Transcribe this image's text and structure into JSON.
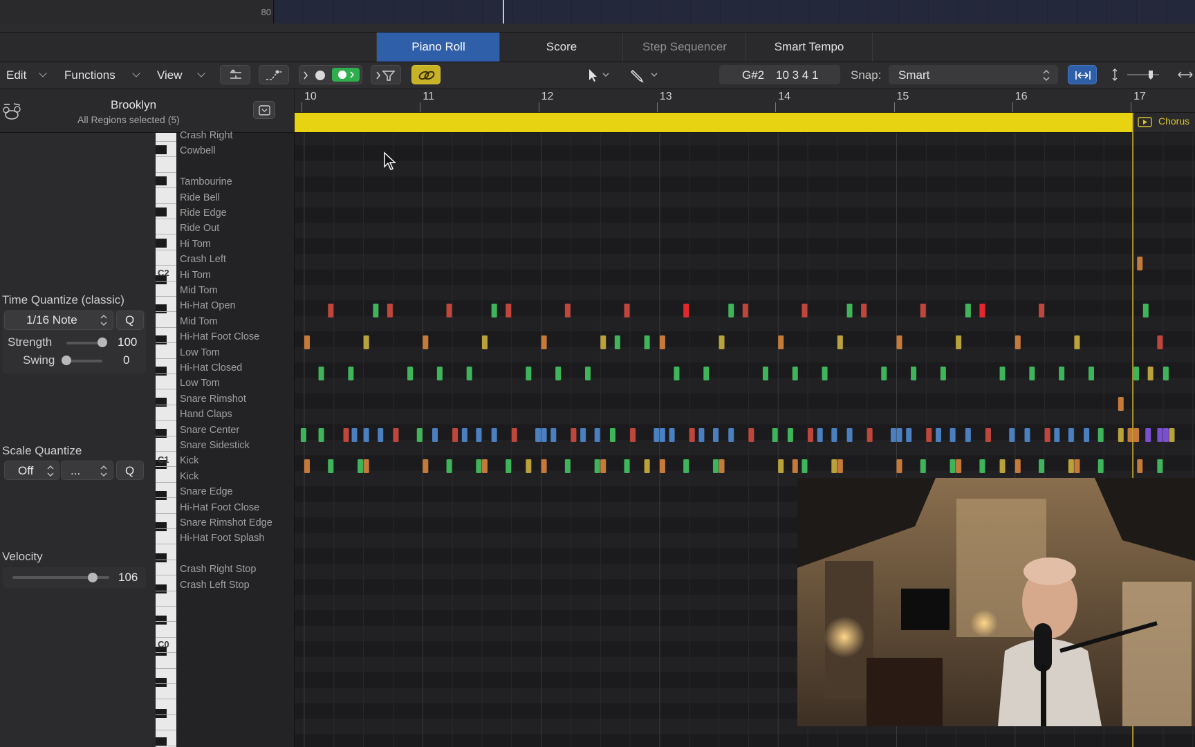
{
  "top": {
    "track_number": "80"
  },
  "tabs": [
    {
      "label": "Piano Roll"
    },
    {
      "label": "Score"
    },
    {
      "label": "Step Sequencer"
    },
    {
      "label": "Smart Tempo"
    }
  ],
  "toolbar": {
    "menus": [
      {
        "label": "Edit"
      },
      {
        "label": "Functions"
      },
      {
        "label": "View"
      }
    ],
    "position_note": "G#2",
    "position_value": "10 3 4 1",
    "snap_label": "Snap:",
    "snap_value": "Smart"
  },
  "region": {
    "name": "Brooklyn",
    "selection": "All Regions selected (5)"
  },
  "inspector": {
    "time_quantize": {
      "label": "Time Quantize (classic)",
      "value": "1/16 Note",
      "q": "Q",
      "strength_label": "Strength",
      "strength_value": "100",
      "strength_fraction": 1.0,
      "swing_label": "Swing",
      "swing_value": "0",
      "swing_fraction": 0.0
    },
    "scale_quantize": {
      "label": "Scale Quantize",
      "value": "Off",
      "scale": "...",
      "q": "Q"
    },
    "velocity": {
      "label": "Velocity",
      "value": "106",
      "fraction": 0.83
    }
  },
  "keyboard": {
    "octaves": [
      "C2",
      "C1",
      "C0"
    ]
  },
  "drum_names": [
    "Crash Right",
    "Cowbell",
    "",
    "Tambourine",
    "Ride Bell",
    "Ride Edge",
    "Ride Out",
    "Hi Tom",
    "Crash Left",
    "Hi Tom",
    "Mid Tom",
    "Hi-Hat Open",
    "Mid Tom",
    "Hi-Hat Foot Close",
    "Low Tom",
    "Hi-Hat Closed",
    "Low Tom",
    "Snare Rimshot",
    "Hand Claps",
    "Snare Center",
    "Snare Sidestick",
    "Kick",
    "Kick",
    "Snare Edge",
    "Hi-Hat Foot Close",
    "Snare Rimshot Edge",
    "Hi-Hat Foot Splash",
    "",
    "Crash Right Stop",
    "Crash Left Stop"
  ],
  "ruler": {
    "bars": [
      "10",
      "11",
      "12",
      "13",
      "14",
      "15",
      "16",
      "17"
    ]
  },
  "next_region": {
    "label": "Chorus"
  },
  "colors": {
    "tab_active": "#2f5fa8",
    "region_yellow": "#e8d313",
    "note_red": "#c0463c",
    "note_green": "#3fb55b",
    "note_blue": "#4a7fc0",
    "note_olive": "#b9a23a",
    "note_orange": "#c67a3a",
    "note_purple": "#7a4fd0"
  },
  "notes": {
    "hihat_open": [
      {
        "bar": 10.2,
        "c": "red"
      },
      {
        "bar": 10.58,
        "c": "green"
      },
      {
        "bar": 10.7,
        "c": "red"
      },
      {
        "bar": 11.2,
        "c": "red"
      },
      {
        "bar": 11.58,
        "c": "green"
      },
      {
        "bar": 11.7,
        "c": "red"
      },
      {
        "bar": 12.2,
        "c": "red"
      },
      {
        "bar": 12.7,
        "c": "red"
      },
      {
        "bar": 13.2,
        "c": "brightred"
      },
      {
        "bar": 13.58,
        "c": "green"
      },
      {
        "bar": 13.7,
        "c": "red"
      },
      {
        "bar": 14.2,
        "c": "red"
      },
      {
        "bar": 14.58,
        "c": "green"
      },
      {
        "bar": 14.7,
        "c": "red"
      },
      {
        "bar": 15.2,
        "c": "red"
      },
      {
        "bar": 15.58,
        "c": "green"
      },
      {
        "bar": 15.7,
        "c": "brightred"
      },
      {
        "bar": 16.2,
        "c": "red"
      },
      {
        "bar": 17.08,
        "c": "green"
      }
    ],
    "hihat_foot_close": [
      {
        "bar": 10.0,
        "c": "orange"
      },
      {
        "bar": 10.5,
        "c": "olive"
      },
      {
        "bar": 11.0,
        "c": "orange"
      },
      {
        "bar": 11.5,
        "c": "olive"
      },
      {
        "bar": 12.0,
        "c": "orange"
      },
      {
        "bar": 12.5,
        "c": "olive"
      },
      {
        "bar": 12.62,
        "c": "green"
      },
      {
        "bar": 12.87,
        "c": "green"
      },
      {
        "bar": 13.0,
        "c": "orange"
      },
      {
        "bar": 13.5,
        "c": "olive"
      },
      {
        "bar": 14.0,
        "c": "orange"
      },
      {
        "bar": 14.5,
        "c": "olive"
      },
      {
        "bar": 15.0,
        "c": "orange"
      },
      {
        "bar": 15.5,
        "c": "olive"
      },
      {
        "bar": 16.0,
        "c": "orange"
      },
      {
        "bar": 16.5,
        "c": "olive"
      },
      {
        "bar": 17.2,
        "c": "red"
      }
    ],
    "hihat_closed": [
      {
        "bar": 10.12,
        "c": "green"
      },
      {
        "bar": 10.37,
        "c": "green"
      },
      {
        "bar": 10.87,
        "c": "green"
      },
      {
        "bar": 11.12,
        "c": "green"
      },
      {
        "bar": 11.37,
        "c": "green"
      },
      {
        "bar": 11.87,
        "c": "green"
      },
      {
        "bar": 12.12,
        "c": "green"
      },
      {
        "bar": 12.37,
        "c": "green"
      },
      {
        "bar": 13.12,
        "c": "green"
      },
      {
        "bar": 13.37,
        "c": "green"
      },
      {
        "bar": 13.87,
        "c": "green"
      },
      {
        "bar": 14.12,
        "c": "green"
      },
      {
        "bar": 14.37,
        "c": "green"
      },
      {
        "bar": 14.87,
        "c": "green"
      },
      {
        "bar": 15.12,
        "c": "green"
      },
      {
        "bar": 15.37,
        "c": "green"
      },
      {
        "bar": 15.87,
        "c": "green"
      },
      {
        "bar": 16.12,
        "c": "green"
      },
      {
        "bar": 16.37,
        "c": "green"
      },
      {
        "bar": 16.62,
        "c": "green"
      },
      {
        "bar": 17.0,
        "c": "green"
      },
      {
        "bar": 17.12,
        "c": "olive"
      },
      {
        "bar": 17.25,
        "c": "green"
      }
    ],
    "snare_rimshot": [
      {
        "bar": 16.87,
        "c": "orange"
      }
    ],
    "crash_left": [
      {
        "bar": 17.03,
        "c": "orange"
      }
    ],
    "snare_center": [
      {
        "bar": 9.97,
        "c": "green"
      },
      {
        "bar": 10.12,
        "c": "green"
      },
      {
        "bar": 10.33,
        "c": "red"
      },
      {
        "bar": 10.4,
        "c": "blue"
      },
      {
        "bar": 10.5,
        "c": "blue"
      },
      {
        "bar": 10.62,
        "c": "blue"
      },
      {
        "bar": 10.75,
        "c": "red"
      },
      {
        "bar": 10.95,
        "c": "green"
      },
      {
        "bar": 11.08,
        "c": "blue"
      },
      {
        "bar": 11.25,
        "c": "red"
      },
      {
        "bar": 11.33,
        "c": "blue"
      },
      {
        "bar": 11.45,
        "c": "blue"
      },
      {
        "bar": 11.58,
        "c": "blue"
      },
      {
        "bar": 11.75,
        "c": "red"
      },
      {
        "bar": 11.95,
        "c": "blue"
      },
      {
        "bar": 12.0,
        "c": "blue"
      },
      {
        "bar": 12.08,
        "c": "blue"
      },
      {
        "bar": 12.25,
        "c": "red"
      },
      {
        "bar": 12.33,
        "c": "blue"
      },
      {
        "bar": 12.45,
        "c": "blue"
      },
      {
        "bar": 12.58,
        "c": "green"
      },
      {
        "bar": 12.75,
        "c": "red"
      },
      {
        "bar": 12.95,
        "c": "blue"
      },
      {
        "bar": 13.0,
        "c": "blue"
      },
      {
        "bar": 13.08,
        "c": "blue"
      },
      {
        "bar": 13.25,
        "c": "red"
      },
      {
        "bar": 13.33,
        "c": "blue"
      },
      {
        "bar": 13.45,
        "c": "blue"
      },
      {
        "bar": 13.58,
        "c": "blue"
      },
      {
        "bar": 13.75,
        "c": "red"
      },
      {
        "bar": 13.95,
        "c": "green"
      },
      {
        "bar": 14.08,
        "c": "green"
      },
      {
        "bar": 14.25,
        "c": "red"
      },
      {
        "bar": 14.33,
        "c": "blue"
      },
      {
        "bar": 14.45,
        "c": "blue"
      },
      {
        "bar": 14.58,
        "c": "blue"
      },
      {
        "bar": 14.75,
        "c": "red"
      },
      {
        "bar": 14.95,
        "c": "blue"
      },
      {
        "bar": 15.0,
        "c": "blue"
      },
      {
        "bar": 15.08,
        "c": "blue"
      },
      {
        "bar": 15.25,
        "c": "red"
      },
      {
        "bar": 15.33,
        "c": "blue"
      },
      {
        "bar": 15.45,
        "c": "blue"
      },
      {
        "bar": 15.58,
        "c": "blue"
      },
      {
        "bar": 15.75,
        "c": "red"
      },
      {
        "bar": 15.95,
        "c": "blue"
      },
      {
        "bar": 16.08,
        "c": "blue"
      },
      {
        "bar": 16.25,
        "c": "red"
      },
      {
        "bar": 16.33,
        "c": "blue"
      },
      {
        "bar": 16.45,
        "c": "blue"
      },
      {
        "bar": 16.58,
        "c": "blue"
      },
      {
        "bar": 16.7,
        "c": "green"
      },
      {
        "bar": 16.87,
        "c": "olive"
      },
      {
        "bar": 16.95,
        "c": "orange"
      },
      {
        "bar": 17.0,
        "c": "orange"
      },
      {
        "bar": 17.1,
        "c": "purple"
      },
      {
        "bar": 17.2,
        "c": "purple"
      },
      {
        "bar": 17.25,
        "c": "purple"
      },
      {
        "bar": 17.3,
        "c": "olive"
      }
    ],
    "kick": [
      {
        "bar": 10.0,
        "c": "orange"
      },
      {
        "bar": 10.2,
        "c": "green"
      },
      {
        "bar": 10.45,
        "c": "green"
      },
      {
        "bar": 10.5,
        "c": "orange"
      },
      {
        "bar": 11.0,
        "c": "orange"
      },
      {
        "bar": 11.2,
        "c": "green"
      },
      {
        "bar": 11.45,
        "c": "green"
      },
      {
        "bar": 11.5,
        "c": "orange"
      },
      {
        "bar": 11.7,
        "c": "green"
      },
      {
        "bar": 11.87,
        "c": "olive"
      },
      {
        "bar": 12.0,
        "c": "orange"
      },
      {
        "bar": 12.2,
        "c": "green"
      },
      {
        "bar": 12.45,
        "c": "green"
      },
      {
        "bar": 12.5,
        "c": "orange"
      },
      {
        "bar": 12.7,
        "c": "green"
      },
      {
        "bar": 12.87,
        "c": "olive"
      },
      {
        "bar": 13.0,
        "c": "orange"
      },
      {
        "bar": 13.2,
        "c": "green"
      },
      {
        "bar": 13.45,
        "c": "green"
      },
      {
        "bar": 13.5,
        "c": "orange"
      },
      {
        "bar": 14.0,
        "c": "olive"
      },
      {
        "bar": 14.12,
        "c": "orange"
      },
      {
        "bar": 14.2,
        "c": "green"
      },
      {
        "bar": 14.45,
        "c": "olive"
      },
      {
        "bar": 14.5,
        "c": "orange"
      },
      {
        "bar": 15.0,
        "c": "orange"
      },
      {
        "bar": 15.2,
        "c": "green"
      },
      {
        "bar": 15.45,
        "c": "green"
      },
      {
        "bar": 15.5,
        "c": "orange"
      },
      {
        "bar": 15.7,
        "c": "green"
      },
      {
        "bar": 15.87,
        "c": "olive"
      },
      {
        "bar": 16.0,
        "c": "orange"
      },
      {
        "bar": 16.2,
        "c": "green"
      },
      {
        "bar": 16.45,
        "c": "olive"
      },
      {
        "bar": 16.5,
        "c": "orange"
      },
      {
        "bar": 16.7,
        "c": "green"
      },
      {
        "bar": 17.03,
        "c": "orange"
      },
      {
        "bar": 17.2,
        "c": "green"
      }
    ]
  }
}
